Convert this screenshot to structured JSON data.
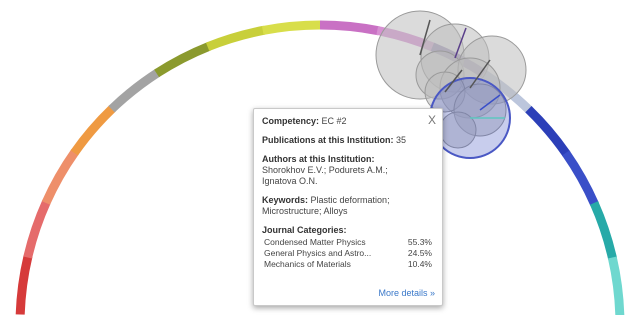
{
  "popup": {
    "competency_label": "Competency:",
    "competency_value": "EC #2",
    "close_label": "X",
    "publications_label": "Publications at this Institution:",
    "publications_value": "35",
    "authors_label": "Authors at this Institution:",
    "authors_line1": "Shorokhov E.V.; Podurets A.M.;",
    "authors_line2": "Ignatova O.N.",
    "keywords_label": "Keywords:",
    "keywords_line1": "Plastic deformation;",
    "keywords_line2": "Microstructure; Alloys",
    "journal_label": "Journal Categories:",
    "journal_categories": [
      {
        "name": "Condensed Matter Physics",
        "pct": "55.3%"
      },
      {
        "name": "General Physics and Astro...",
        "pct": "24.5%"
      },
      {
        "name": "Mechanics of Materials",
        "pct": "10.4%"
      }
    ],
    "more_details": "More details »"
  },
  "colors": {
    "ring_segments": [
      "#d63a3a",
      "#e56b6b",
      "#ee8f6a",
      "#ef9a42",
      "#a3a3a3",
      "#8b9a2e",
      "#c8cf3a",
      "#d8de4a",
      "#c971c4",
      "#d790d2",
      "#7c6aa8",
      "#bcc6dc",
      "#2c3fb8",
      "#3a4fc8",
      "#27aaa8",
      "#6fd8cf"
    ],
    "highlight_circle": "#4a58c4",
    "bubble": "#bdbdbd"
  }
}
